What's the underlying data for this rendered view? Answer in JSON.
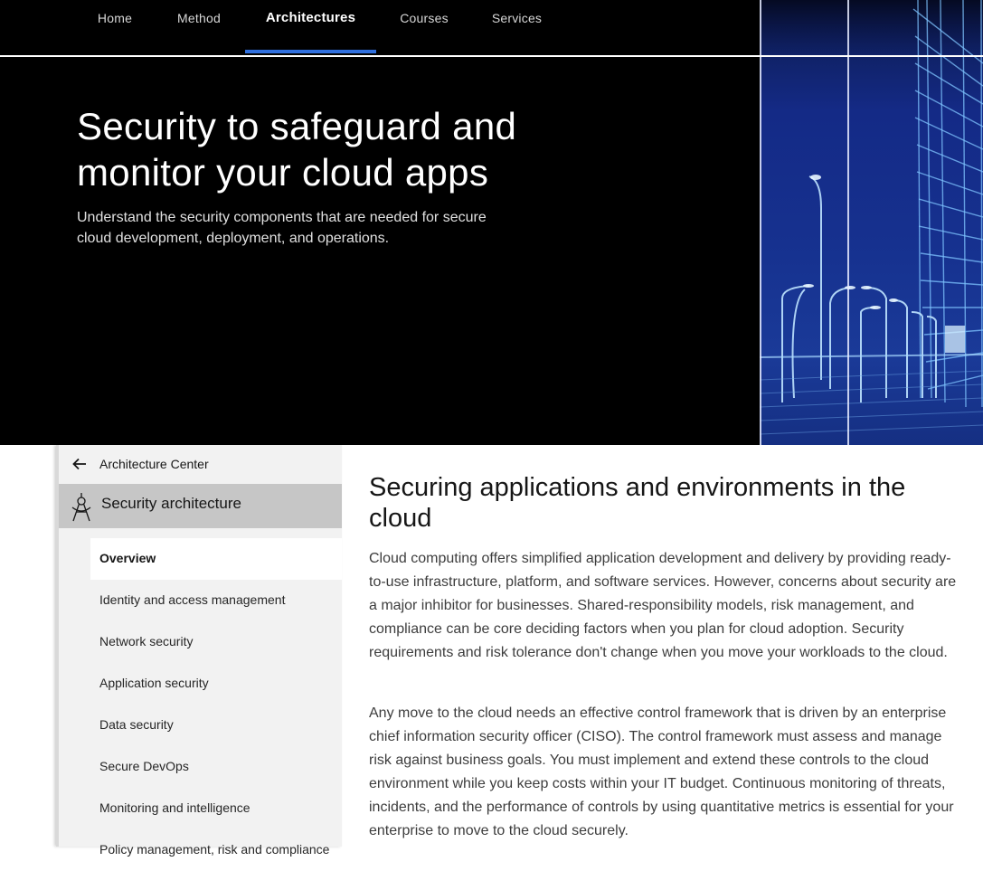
{
  "nav": {
    "items": [
      {
        "label": "Home",
        "active": false
      },
      {
        "label": "Method",
        "active": false
      },
      {
        "label": "Architectures",
        "active": true
      },
      {
        "label": "Courses",
        "active": false
      },
      {
        "label": "Services",
        "active": false
      }
    ],
    "accent_color": "#2f6fde"
  },
  "hero": {
    "title": "Security to safeguard and monitor your cloud apps",
    "subtitle": "Understand the security components that are needed for secure cloud development, deployment, and operations.",
    "image": "wireframe-city-street-illustration"
  },
  "sidebar": {
    "back_label": "Architecture Center",
    "back_icon": "arrow-left-icon",
    "section_label": "Security architecture",
    "section_icon": "compass-drafting-icon",
    "items": [
      {
        "label": "Overview",
        "active": true
      },
      {
        "label": "Identity and access management",
        "active": false
      },
      {
        "label": "Network security",
        "active": false
      },
      {
        "label": "Application security",
        "active": false
      },
      {
        "label": "Data security",
        "active": false
      },
      {
        "label": "Secure DevOps",
        "active": false
      },
      {
        "label": "Monitoring and intelligence",
        "active": false
      },
      {
        "label": "Policy management, risk and compliance",
        "active": false
      }
    ]
  },
  "main": {
    "heading": "Securing applications and environments in the cloud",
    "paragraphs": [
      "Cloud computing offers simplified application development and delivery by providing ready-to-use infrastructure, platform, and software services. However, concerns about security are a major inhibitor for businesses. Shared-responsibility models, risk management, and compliance can be core deciding factors when you plan for cloud adoption. Security requirements and risk tolerance don't change when you move your workloads to the cloud.",
      "Any move to the cloud needs an effective control framework that is driven by an enterprise chief information security officer (CISO). The control framework must assess and manage risk against business goals. You must implement and extend these controls to the cloud environment while you keep costs within your IT budget. Continuous monitoring of threats, incidents, and the performance of controls by using quantitative metrics is essential for your enterprise to move to the cloud securely."
    ]
  }
}
